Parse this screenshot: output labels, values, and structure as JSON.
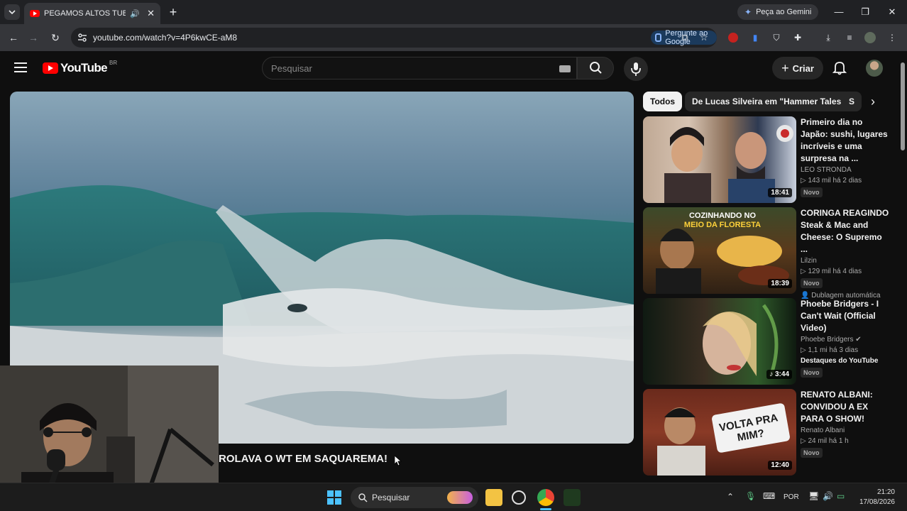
{
  "browser": {
    "tab_title": "PEGAMOS ALTOS TUBOS E",
    "gemini_label": "Peça ao Gemini",
    "url": "youtube.com/watch?v=4P6kwCE-aM8",
    "ask_google_label": "Pergunte ao Google"
  },
  "youtube": {
    "logo_text": "YouTube",
    "country_code": "BR",
    "search_placeholder": "Pesquisar",
    "create_label": "Criar",
    "video_title": "ROLAVA O WT EM SAQUAREMA!",
    "chips": [
      "Todos",
      "De Lucas Silveira em \"Hammer Tales\"",
      "S"
    ],
    "recommendations": [
      {
        "title": "Primeiro dia no Japão: sushi, lugares incríveis e uma surpresa na ...",
        "channel": "LEO STRONDA",
        "meta": "▷ 143 mil  há 2 dias",
        "badge": "Novo",
        "duration": "18:41",
        "extra": ""
      },
      {
        "title": "CORINGA REAGINDO Steak & Mac and Cheese: O Supremo ...",
        "channel": "Lilzin",
        "meta": "▷ 129 mil  há 4 dias",
        "badge": "Novo",
        "duration": "18:39",
        "extra": "Dublagem automática",
        "thumb_text": "COZINHANDO NO MEIO DA FLORESTA"
      },
      {
        "title": "Phoebe Bridgers - I Can't Wait (Official Video)",
        "channel": "Phoebe Bridgers",
        "meta": "▷ 1,1 mi  há 3 dias",
        "badge": "Novo",
        "duration": "3:44",
        "extra": "Destaques do YouTube"
      },
      {
        "title": "RENATO ALBANI: CONVIDOU A EX PARA O SHOW!",
        "channel": "Renato Albani",
        "meta": "▷ 24 mil  há 1 h",
        "badge": "Novo",
        "duration": "12:40",
        "extra": "",
        "thumb_text": "VOLTA PRA MIM?"
      }
    ]
  },
  "taskbar": {
    "search_placeholder": "Pesquisar",
    "language": "POR",
    "time": "21:20",
    "date": "17/08/2026"
  },
  "colors": {
    "youtube_red": "#ff0000",
    "background": "#0f0f0f",
    "windows_accent": "#4cc2ff"
  }
}
